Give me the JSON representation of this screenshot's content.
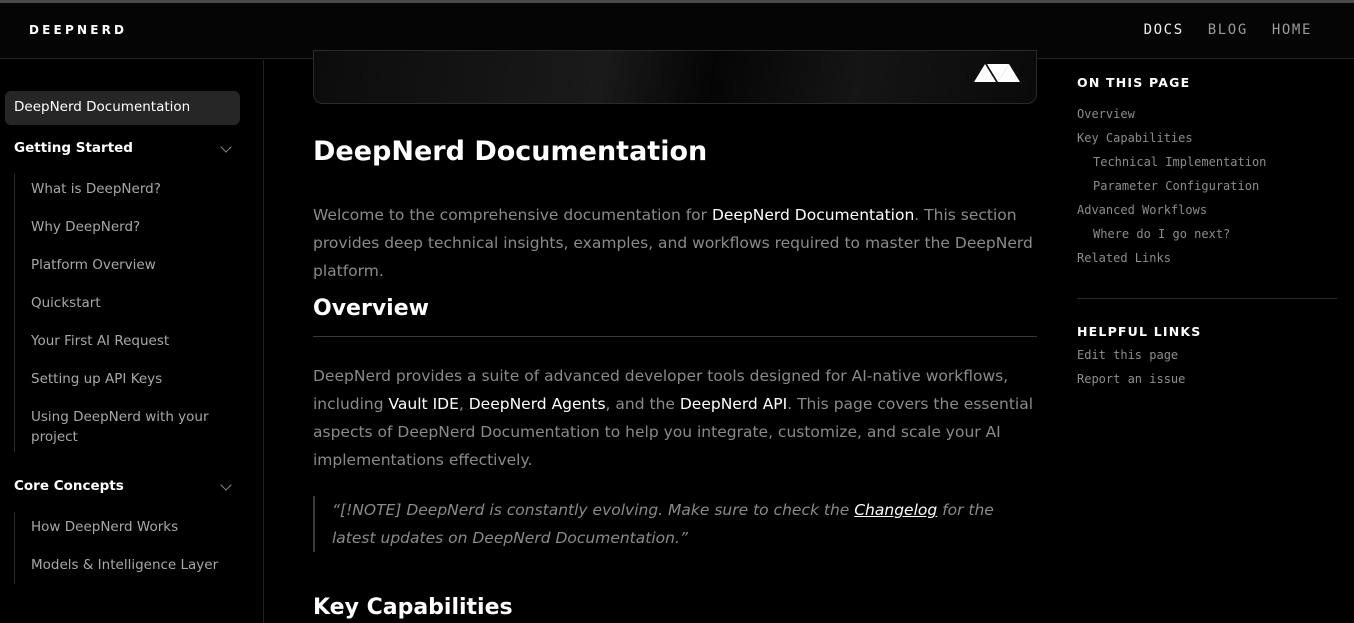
{
  "header": {
    "brand": "DEEPNERD",
    "nav": [
      {
        "label": "DOCS",
        "active": true
      },
      {
        "label": "BLOG",
        "active": false
      },
      {
        "label": "HOME",
        "active": false
      }
    ]
  },
  "sidebar": {
    "active_item": "DeepNerd Documentation",
    "groups": [
      {
        "title": "Getting Started",
        "items": [
          "What is DeepNerd?",
          "Why DeepNerd?",
          "Platform Overview",
          "Quickstart",
          "Your First AI Request",
          "Setting up API Keys",
          "Using DeepNerd with your project"
        ]
      },
      {
        "title": "Core Concepts",
        "items": [
          "How DeepNerd Works",
          "Models & Intelligence Layer"
        ]
      }
    ]
  },
  "main": {
    "title": "DeepNerd Documentation",
    "intro": {
      "p1": "Welcome to the comprehensive documentation for ",
      "strong": "DeepNerd Documentation",
      "p2": ". This section provides deep technical insights, examples, and workflows required to master the DeepNerd platform."
    },
    "overview_heading": "Overview",
    "overview": {
      "t1": "DeepNerd provides a suite of advanced developer tools designed for AI-native workflows, including ",
      "b1": "Vault IDE",
      "t2": ", ",
      "b2": "DeepNerd Agents",
      "t3": ", and the ",
      "b3": "DeepNerd API",
      "t4": ". This page covers the essential aspects of DeepNerd Documentation to help you integrate, customize, and scale your AI implementations effectively."
    },
    "note": {
      "t1": "“[!NOTE] DeepNerd is constantly evolving. Make sure to check the ",
      "link": "Changelog",
      "t2": " for the latest updates on DeepNerd Documentation.”"
    },
    "key_heading": "Key Capabilities"
  },
  "toc": {
    "title": "ON THIS PAGE",
    "links": [
      {
        "label": "Overview",
        "sub": false
      },
      {
        "label": "Key Capabilities",
        "sub": false
      },
      {
        "label": "Technical Implementation",
        "sub": true
      },
      {
        "label": "Parameter Configuration",
        "sub": true
      },
      {
        "label": "Advanced Workflows",
        "sub": false
      },
      {
        "label": "Where do I go next?",
        "sub": true
      },
      {
        "label": "Related Links",
        "sub": false
      }
    ],
    "helpful_title": "HELPFUL LINKS",
    "helpful": [
      "Edit this page",
      "Report an issue"
    ]
  }
}
